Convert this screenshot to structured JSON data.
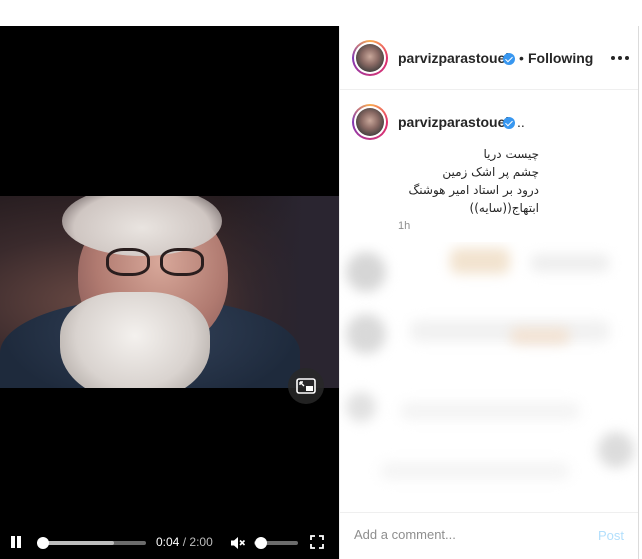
{
  "post": {
    "author": "parvizparastouei",
    "follow_label": "Following",
    "dot": "•",
    "caption_trail": "..",
    "caption_lines": [
      "چیست دریا",
      "چشم پر اشک زمین",
      "درود بر استاد امیر هوشنگ",
      "ابتهاج((سایه))"
    ],
    "time_ago": "1h"
  },
  "video": {
    "current_time": "0:04",
    "separator": "/",
    "duration": "2:00",
    "progress_fraction": 0.033,
    "buffered_fraction": 0.7,
    "volume_fraction": 0.15,
    "muted": true
  },
  "comment": {
    "placeholder": "Add a comment...",
    "post_label": "Post"
  },
  "colors": {
    "accent": "#3897f0",
    "progress": "#2da0f0",
    "post_disabled": "#b2dffc"
  }
}
